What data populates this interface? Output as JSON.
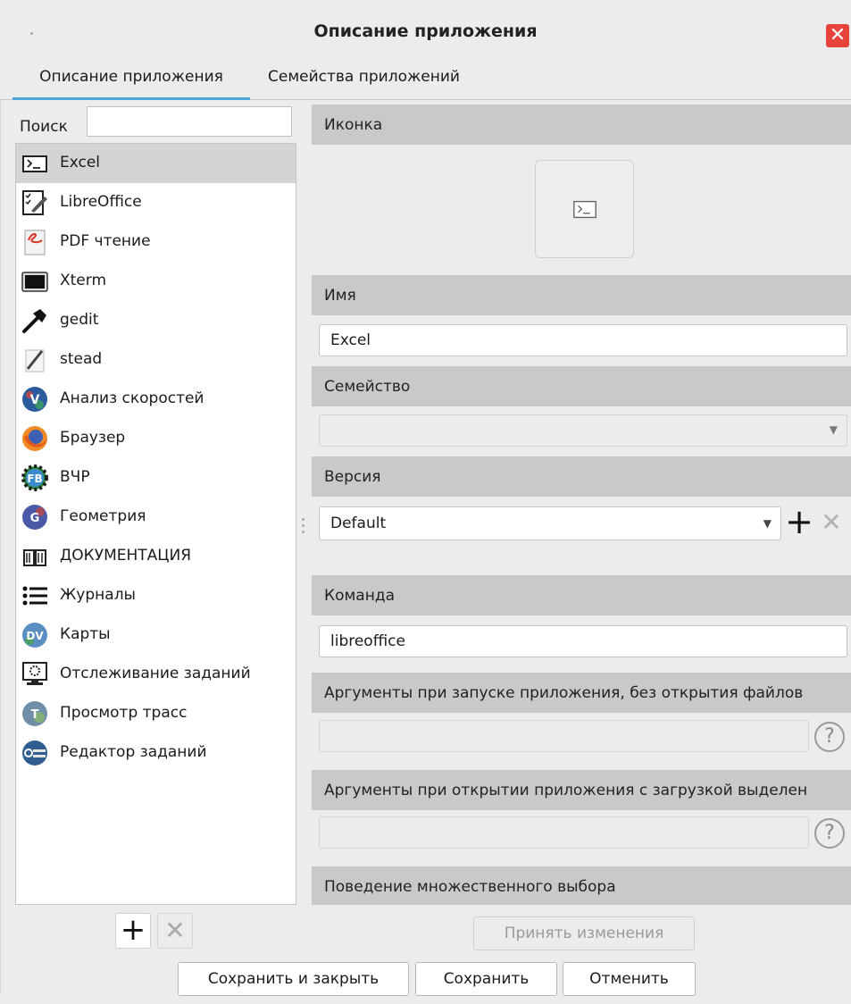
{
  "window": {
    "title": "Описание приложения",
    "close_icon": "close-icon"
  },
  "tabs": [
    {
      "label": "Описание приложения",
      "active": true
    },
    {
      "label": "Семейства приложений",
      "active": false
    }
  ],
  "search": {
    "label": "Поиск",
    "value": ""
  },
  "apps": [
    {
      "label": "Excel",
      "icon": "terminal-icon",
      "selected": true
    },
    {
      "label": "LibreOffice",
      "icon": "checklist-edit-icon"
    },
    {
      "label": "PDF чтение",
      "icon": "pdf-reader-icon"
    },
    {
      "label": "Xterm",
      "icon": "xterm-icon"
    },
    {
      "label": "gedit",
      "icon": "hammer-icon"
    },
    {
      "label": "stead",
      "icon": "pencil-icon"
    },
    {
      "label": "Анализ скоростей",
      "icon": "velocity-analysis-icon"
    },
    {
      "label": "Браузер",
      "icon": "firefox-icon"
    },
    {
      "label": "ВЧР",
      "icon": "fb-gear-icon"
    },
    {
      "label": "Геометрия",
      "icon": "geometry-icon"
    },
    {
      "label": "ДОКУМЕНТАЦИЯ",
      "icon": "book-icon"
    },
    {
      "label": "Журналы",
      "icon": "list-icon"
    },
    {
      "label": "Карты",
      "icon": "dv-maps-icon"
    },
    {
      "label": "Отслеживание заданий",
      "icon": "job-monitor-icon"
    },
    {
      "label": "Просмотр трасс",
      "icon": "trace-viewer-icon"
    },
    {
      "label": "Редактор заданий",
      "icon": "job-editor-icon"
    }
  ],
  "details": {
    "icon_section": "Иконка",
    "name_section": "Имя",
    "name_value": "Excel",
    "family_section": "Семейство",
    "family_value": "",
    "version_section": "Версия",
    "version_value": "Default",
    "command_section": "Команда",
    "command_value": "libreoffice",
    "args_no_files_section": "Аргументы при запуске приложения, без открытия файлов",
    "args_no_files_value": "",
    "args_with_files_section": "Аргументы при открытии приложения с загрузкой выделен",
    "args_with_files_value": "",
    "multiselect_section": "Поведение множественного выбора",
    "help_glyph": "?"
  },
  "buttons": {
    "accept": "Принять изменения",
    "save_close": "Сохранить и закрыть",
    "save": "Сохранить",
    "cancel": "Отменить",
    "add": "+",
    "remove": "✕"
  },
  "colors": {
    "close": "#e6433a",
    "tab_underline": "#4ba3d6",
    "section_bg": "#c9c9c9",
    "selected_row": "#d4d4d4"
  }
}
